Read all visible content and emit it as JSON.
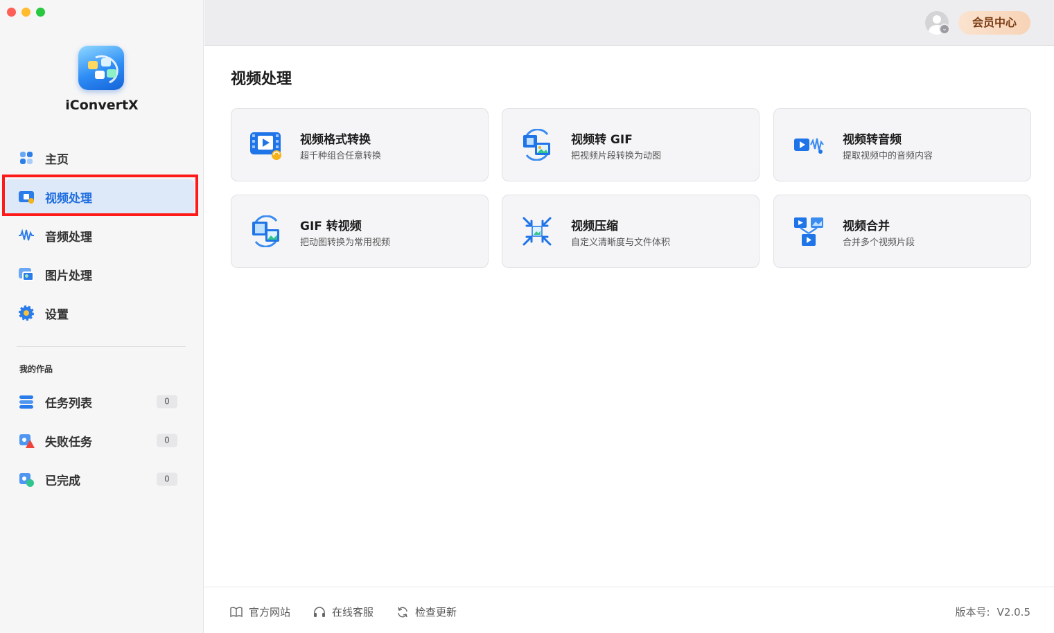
{
  "app": {
    "name": "iConvertX"
  },
  "sidebar": {
    "items": [
      {
        "label": "主页"
      },
      {
        "label": "视频处理"
      },
      {
        "label": "音频处理"
      },
      {
        "label": "图片处理"
      },
      {
        "label": "设置"
      }
    ],
    "section_label": "我的作品",
    "works": [
      {
        "label": "任务列表",
        "count": "0"
      },
      {
        "label": "失败任务",
        "count": "0"
      },
      {
        "label": "已完成",
        "count": "0"
      }
    ]
  },
  "header": {
    "member_label": "会员中心"
  },
  "main": {
    "title": "视频处理",
    "cards": [
      {
        "title": "视频格式转换",
        "desc": "超千种组合任意转换"
      },
      {
        "title": "视频转 GIF",
        "desc": "把视频片段转换为动图"
      },
      {
        "title": "视频转音频",
        "desc": "提取视频中的音频内容"
      },
      {
        "title": "GIF 转视频",
        "desc": "把动图转换为常用视频"
      },
      {
        "title": "视频压缩",
        "desc": "自定义清晰度与文件体积"
      },
      {
        "title": "视频合并",
        "desc": "合并多个视频片段"
      }
    ]
  },
  "footer": {
    "website": "官方网站",
    "support": "在线客服",
    "update": "检查更新",
    "version_label": "版本号:",
    "version_value": "V2.0.5"
  }
}
